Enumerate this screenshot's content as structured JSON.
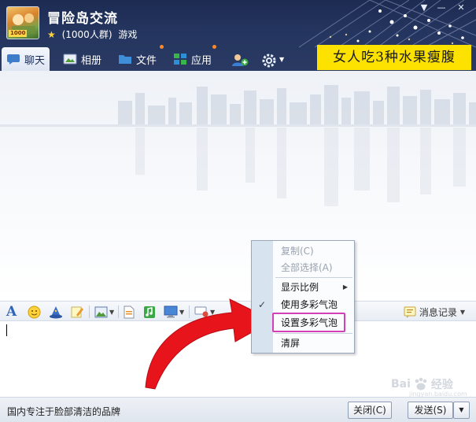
{
  "header": {
    "group_name": "冒险岛交流",
    "member_count": "(1000人群)",
    "category": "游戏",
    "avatar_tag": "1000"
  },
  "tabs": [
    {
      "label": "聊天",
      "icon": "chat-icon"
    },
    {
      "label": "相册",
      "icon": "photo-album-icon"
    },
    {
      "label": "文件",
      "icon": "folder-icon"
    },
    {
      "label": "应用",
      "icon": "apps-icon"
    }
  ],
  "promo": {
    "text": "女人吃3种水果瘦腹"
  },
  "window_controls": {
    "menu": "▼",
    "minimize": "—",
    "close": "✕"
  },
  "toolbar": {
    "history_label": "消息记录"
  },
  "context_menu": {
    "items": [
      {
        "label": "复制(C)",
        "enabled": false
      },
      {
        "label": "全部选择(A)",
        "enabled": false
      },
      {
        "label": "显示比例",
        "submenu": true
      },
      {
        "label": "使用多彩气泡",
        "checked": true
      },
      {
        "label": "设置多彩气泡",
        "highlighted": true
      },
      {
        "label": "清屏"
      }
    ],
    "check_mark": "✓"
  },
  "bottom_bar": {
    "ad_text": "国内专注于脸部清洁的品牌",
    "close_label": "关闭(C)",
    "send_label": "发送(S)",
    "send_options": "▼"
  },
  "watermark": {
    "text": "Bai",
    "suffix": "经验",
    "sub": "jingyan.baidu.com"
  },
  "colors": {
    "header": "#24355f",
    "promo": "#fde200",
    "highlight": "#d23fb7",
    "arrow": "#e8141c",
    "menu_gutter": "#d7e3ee"
  }
}
